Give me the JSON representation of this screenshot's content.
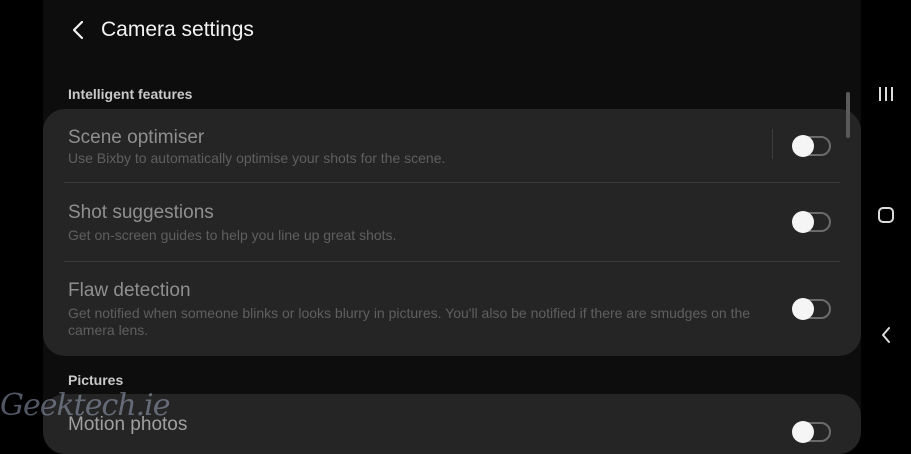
{
  "header": {
    "title": "Camera settings"
  },
  "sections": [
    {
      "label": "Intelligent features",
      "items": [
        {
          "title": "Scene optimiser",
          "description": "Use Bixby to automatically optimise your shots for the scene.",
          "enabled": false
        },
        {
          "title": "Shot suggestions",
          "description": "Get on-screen guides to help you line up great shots.",
          "enabled": false
        },
        {
          "title": "Flaw detection",
          "description": "Get notified when someone blinks or looks blurry in pictures. You'll also be notified if there are smudges on the camera lens.",
          "enabled": false
        }
      ]
    },
    {
      "label": "Pictures",
      "items": [
        {
          "title": "Motion photos",
          "enabled": false
        }
      ]
    }
  ],
  "navbar": {
    "icons": [
      "recents-icon",
      "home-icon",
      "back-icon"
    ]
  },
  "watermark": "Geektech.ie",
  "colors": {
    "background": "#0d0d0d",
    "card": "#252525"
  }
}
